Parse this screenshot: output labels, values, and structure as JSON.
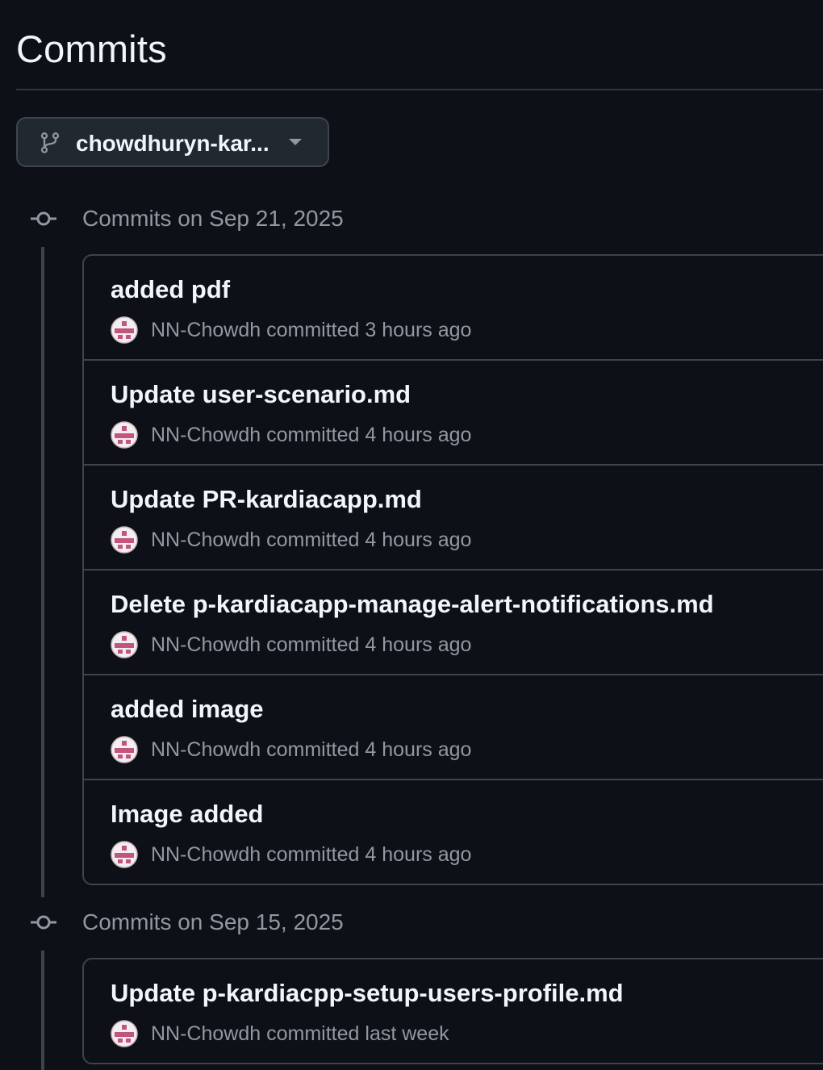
{
  "page": {
    "title": "Commits"
  },
  "branch_selector": {
    "label": "chowdhuryn-kar...",
    "icon": "git-branch-icon"
  },
  "groups": [
    {
      "title": "Commits on Sep 21, 2025",
      "commits": [
        {
          "message": "added pdf",
          "author": "NN-Chowdh",
          "verb": "committed",
          "time": "3 hours ago"
        },
        {
          "message": "Update user-scenario.md",
          "author": "NN-Chowdh",
          "verb": "committed",
          "time": "4 hours ago"
        },
        {
          "message": "Update PR-kardiacapp.md",
          "author": "NN-Chowdh",
          "verb": "committed",
          "time": "4 hours ago"
        },
        {
          "message": "Delete p-kardiacapp-manage-alert-notifications.md",
          "author": "NN-Chowdh",
          "verb": "committed",
          "time": "4 hours ago"
        },
        {
          "message": "added image",
          "author": "NN-Chowdh",
          "verb": "committed",
          "time": "4 hours ago"
        },
        {
          "message": "Image added",
          "author": "NN-Chowdh",
          "verb": "committed",
          "time": "4 hours ago"
        }
      ]
    },
    {
      "title": "Commits on Sep 15, 2025",
      "commits": [
        {
          "message": "Update p-kardiacpp-setup-users-profile.md",
          "author": "NN-Chowdh",
          "verb": "committed",
          "time": "last week"
        }
      ]
    }
  ],
  "colors": {
    "background": "#0d1117",
    "border": "#3d444d",
    "text_primary": "#f0f6fc",
    "text_muted": "#9198a1",
    "avatar_accent": "#c2557f"
  }
}
